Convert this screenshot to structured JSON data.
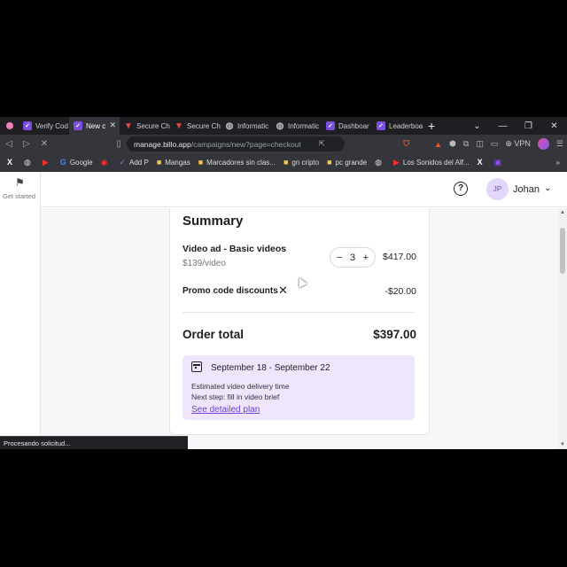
{
  "browser": {
    "tabs": [
      {
        "label": "Verify Cod",
        "favicon": "billo-icon",
        "active": false
      },
      {
        "label": "New c",
        "favicon": "billo-icon",
        "active": true
      },
      {
        "label": "Secure Ch",
        "favicon": "secure-icon",
        "active": false
      },
      {
        "label": "Secure Ch",
        "favicon": "secure-icon",
        "active": false
      },
      {
        "label": "Informatic",
        "favicon": "globe-icon",
        "active": false
      },
      {
        "label": "Informatic",
        "favicon": "globe-icon",
        "active": false
      },
      {
        "label": "Dashboar",
        "favicon": "billo-icon",
        "active": false
      },
      {
        "label": "Leaderboa",
        "favicon": "billo-icon",
        "active": false
      }
    ],
    "url_host": "manage.billo.app",
    "url_path": "/campaigns/new?page=checkout",
    "vpn_label": "VPN",
    "bookmarks": [
      {
        "label": "",
        "icon": "x-icon"
      },
      {
        "label": "",
        "icon": "globe-icon"
      },
      {
        "label": "",
        "icon": "youtube-icon"
      },
      {
        "label": "Google",
        "icon": "google-icon"
      },
      {
        "label": "",
        "icon": "app-icon"
      },
      {
        "label": "Add P",
        "icon": "billo-icon"
      },
      {
        "label": "Mangas",
        "icon": "folder-icon"
      },
      {
        "label": "Marcadores sin clas...",
        "icon": "folder-icon"
      },
      {
        "label": "gn cripto",
        "icon": "folder-icon"
      },
      {
        "label": "pc grande",
        "icon": "folder-icon"
      },
      {
        "label": "",
        "icon": "globe-icon"
      },
      {
        "label": "Los Sonidos del Alf...",
        "icon": "youtube-icon"
      },
      {
        "label": "",
        "icon": "x-icon"
      },
      {
        "label": "",
        "icon": "twitch-icon"
      }
    ],
    "status_text": "Procesando solicitud..."
  },
  "sidebar": {
    "get_started": "Get started"
  },
  "header": {
    "user_initials": "JP",
    "user_name": "Johan"
  },
  "summary": {
    "title": "Summary",
    "item_name": "Video ad - Basic videos",
    "item_unit_price": "$139/video",
    "quantity": "3",
    "item_total": "$417.00",
    "promo_label": "Promo code discounts",
    "promo_value": "-$20.00",
    "order_total_label": "Order total",
    "order_total_value": "$397.00",
    "plan": {
      "dates": "September 18 - September 22",
      "estimate": "Estimated video delivery time",
      "next_step": "Next step: fill in video brief",
      "link": "See detailed plan"
    }
  },
  "colors": {
    "accent": "#6d3fd6",
    "plan_bg": "#efe6fd",
    "avatar_bg": "#e2d6fb"
  }
}
